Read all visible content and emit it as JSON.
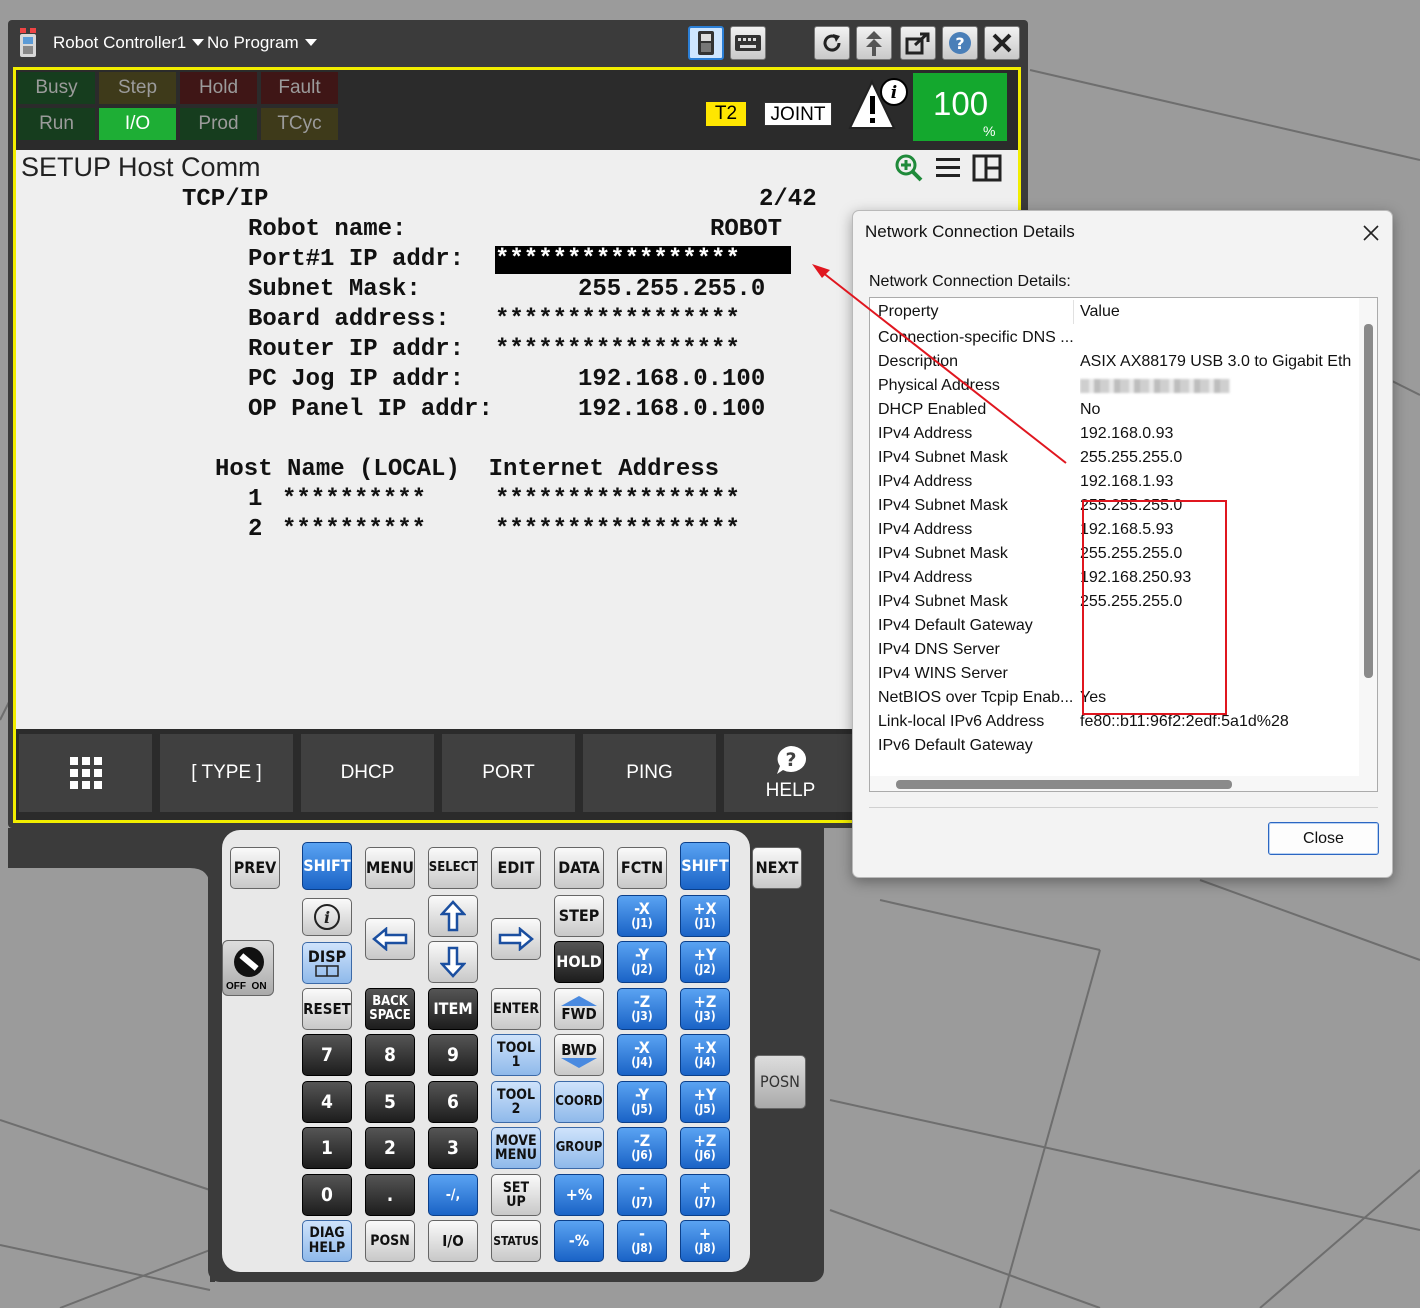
{
  "window": {
    "controller": "Robot Controller1",
    "program": "No Program"
  },
  "status": {
    "leds": [
      "Busy",
      "Step",
      "Hold",
      "Fault",
      "Run",
      "I/O",
      "Prod",
      "TCyc"
    ],
    "mode": "T2",
    "coord": "JOINT",
    "override_value": "100",
    "override_unit": "%"
  },
  "screen": {
    "title": "SETUP Host Comm",
    "header_left": "TCP/IP",
    "page": "2/42",
    "lines": [
      {
        "label": "Robot name:",
        "value": "ROBOT"
      },
      {
        "label": "Port#1 IP addr:",
        "value": "*****************"
      },
      {
        "label": "Subnet Mask:",
        "value": "255.255.255.0"
      },
      {
        "label": "Board address:",
        "value": "*****************"
      },
      {
        "label": "Router IP addr:",
        "value": "*****************"
      },
      {
        "label": "PC Jog IP addr:",
        "value": "192.168.0.100"
      },
      {
        "label": "OP Panel IP addr:",
        "value": "192.168.0.100"
      }
    ],
    "host_header": "Host Name (LOCAL)  Internet Address",
    "hosts": [
      {
        "num": "1",
        "name": "**********",
        "addr": "*****************"
      },
      {
        "num": "2",
        "name": "**********",
        "addr": "*****************"
      }
    ],
    "fkeys": [
      "[ TYPE ]",
      "DHCP",
      "PORT",
      "PING",
      "HELP"
    ]
  },
  "keypad": {
    "row1": [
      "PREV",
      "SHIFT",
      "MENU",
      "SELECT",
      "EDIT",
      "DATA",
      "FCTN",
      "SHIFT",
      "NEXT"
    ],
    "disp": "DISP",
    "step": "STEP",
    "hold": "HOLD",
    "fwd": "FWD",
    "bwd": "BWD",
    "coord": "COORD",
    "group": "GROUP",
    "reset": "RESET",
    "back_space": "BACK SPACE",
    "item": "ITEM",
    "enter": "ENTER",
    "tool1": "TOOL 1",
    "tool2": "TOOL 2",
    "move_menu": "MOVE MENU",
    "set_up": "SET UP",
    "status": "STATUS",
    "diag_help": "DIAG HELP",
    "posn": "POSN",
    "io": "I/O",
    "posn_side": "POSN",
    "numbers": [
      "7",
      "8",
      "9",
      "4",
      "5",
      "6",
      "1",
      "2",
      "3",
      "0",
      "."
    ],
    "minus_key": "-/,",
    "plus_pct": "+%",
    "minus_pct": "-%",
    "jog_left": [
      "-X",
      "-Y",
      "-Z",
      "-X",
      "-Y",
      "-Z",
      "-",
      "-"
    ],
    "jog_right": [
      "+X",
      "+Y",
      "+Z",
      "+X",
      "+Y",
      "+Z",
      "+",
      "+"
    ],
    "jog_left_sub": [
      "(J1)",
      "(J2)",
      "(J3)",
      "(J4)",
      "(J5)",
      "(J6)",
      "(J7)",
      "(J8)"
    ],
    "jog_right_sub": [
      "(J1)",
      "(J2)",
      "(J3)",
      "(J4)",
      "(J5)",
      "(J6)",
      "(J7)",
      "(J8)"
    ],
    "enable_switch": "OFF  ON"
  },
  "dialog": {
    "title": "Network Connection Details",
    "label": "Network Connection Details:",
    "col_property": "Property",
    "col_value": "Value",
    "rows": [
      {
        "p": "Connection-specific DNS ...",
        "v": ""
      },
      {
        "p": "Description",
        "v": "ASIX AX88179 USB 3.0 to Gigabit Eth"
      },
      {
        "p": "Physical Address",
        "v": ""
      },
      {
        "p": "DHCP Enabled",
        "v": "No"
      },
      {
        "p": "IPv4 Address",
        "v": "192.168.0.93"
      },
      {
        "p": "IPv4 Subnet Mask",
        "v": "255.255.255.0"
      },
      {
        "p": "IPv4 Address",
        "v": "192.168.1.93"
      },
      {
        "p": "IPv4 Subnet Mask",
        "v": "255.255.255.0"
      },
      {
        "p": "IPv4 Address",
        "v": "192.168.5.93"
      },
      {
        "p": "IPv4 Subnet Mask",
        "v": "255.255.255.0"
      },
      {
        "p": "IPv4 Address",
        "v": "192.168.250.93"
      },
      {
        "p": "IPv4 Subnet Mask",
        "v": "255.255.255.0"
      },
      {
        "p": "IPv4 Default Gateway",
        "v": ""
      },
      {
        "p": "IPv4 DNS Server",
        "v": ""
      },
      {
        "p": "IPv4 WINS Server",
        "v": ""
      },
      {
        "p": "NetBIOS over Tcpip Enab...",
        "v": "Yes"
      },
      {
        "p": "Link-local IPv6 Address",
        "v": "fe80::b11:96f2:2edf:5a1d%28"
      },
      {
        "p": "IPv6 Default Gateway",
        "v": ""
      }
    ],
    "close_label": "Close",
    "annotation_color": "#e0161f"
  }
}
